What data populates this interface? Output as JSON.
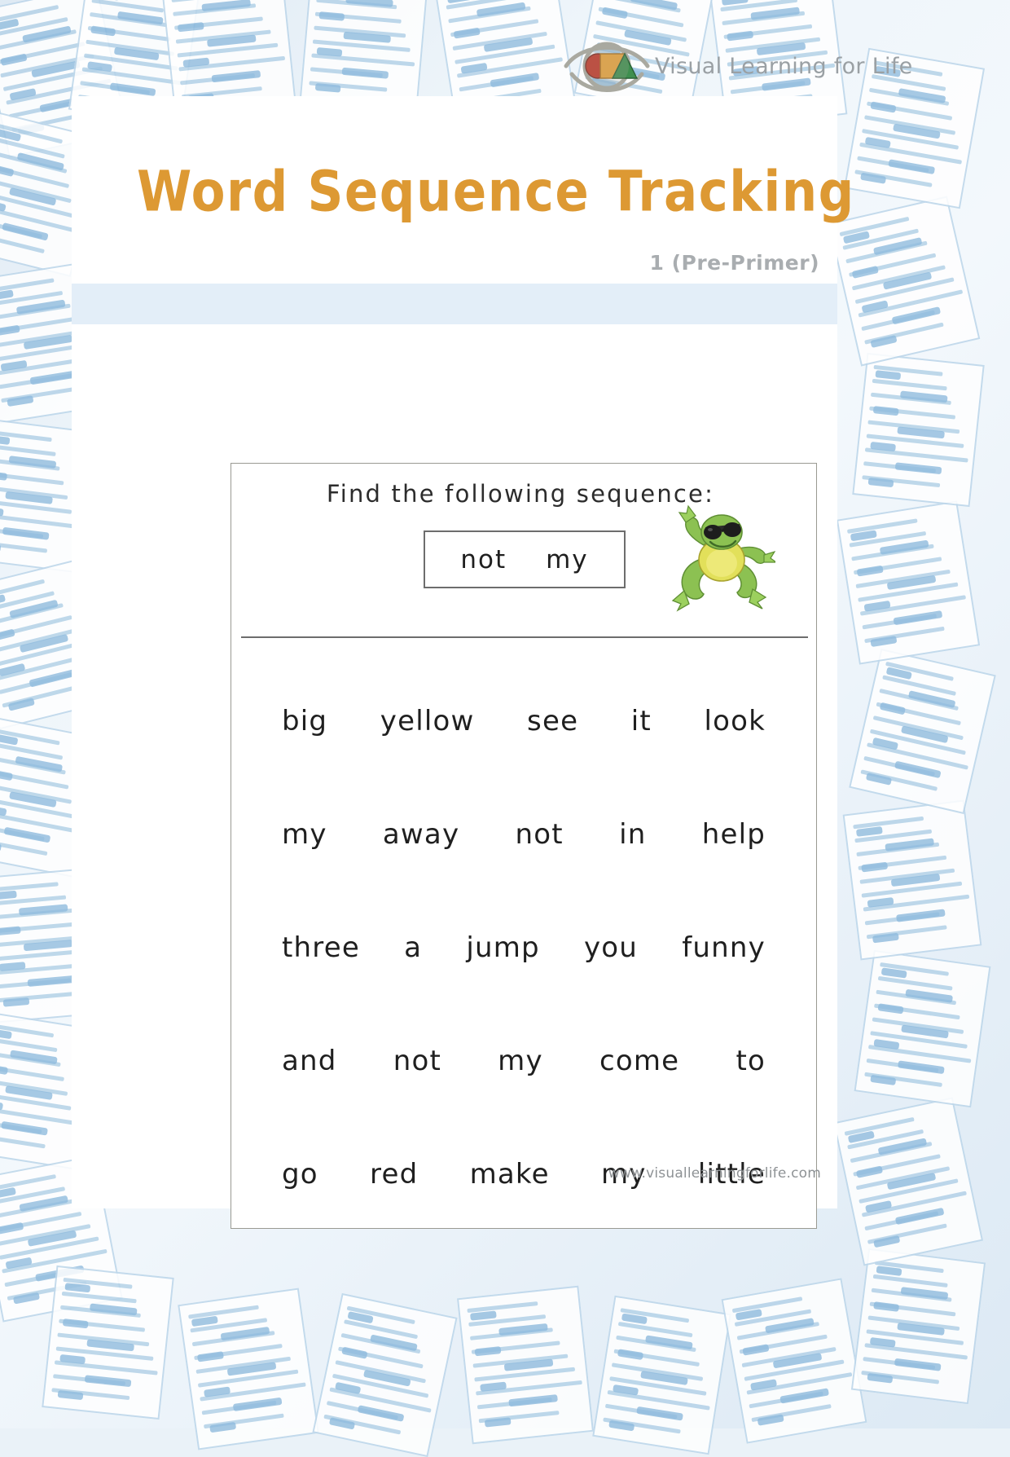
{
  "logo": {
    "text": "Visual Learning for Life",
    "mark_name": "eye-shapes-logo-icon",
    "colors": {
      "eye_outline": "#a9a9a0",
      "circle": "#c0392b",
      "square": "#e8a33d",
      "triangle": "#3f8f4f"
    }
  },
  "header": {
    "title": "Word Sequence Tracking",
    "subtitle": "1 (Pre-Primer)",
    "title_color": "#dd9933",
    "subtitle_color": "#a9adb0"
  },
  "exercise": {
    "prompt": "Find the following sequence:",
    "target_sequence": [
      "not",
      "my"
    ],
    "mascot_name": "frog-mascot-illustration"
  },
  "word_grid": {
    "rows": [
      [
        "big",
        "yellow",
        "see",
        "it",
        "look"
      ],
      [
        "my",
        "away",
        "not",
        "in",
        "help"
      ],
      [
        "three",
        "a",
        "jump",
        "you",
        "funny"
      ],
      [
        "and",
        "not",
        "my",
        "come",
        "to"
      ],
      [
        "go",
        "red",
        "make",
        "my",
        "little"
      ]
    ]
  },
  "footer": {
    "url": "www.visuallearningforlife.com"
  }
}
